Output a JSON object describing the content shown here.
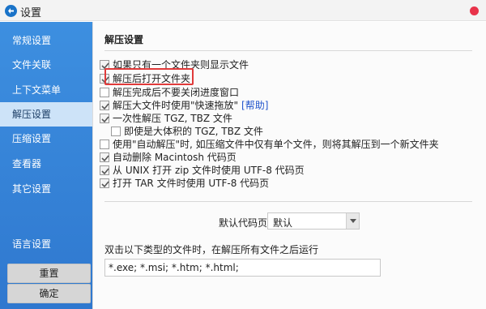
{
  "window": {
    "title": "设置",
    "accent": "#1a73c8",
    "close_color": "#e8334a"
  },
  "sidebar": {
    "items": [
      {
        "label": "常规设置"
      },
      {
        "label": "文件关联"
      },
      {
        "label": "上下文菜单"
      },
      {
        "label": "解压设置",
        "active": true
      },
      {
        "label": "压缩设置"
      },
      {
        "label": "查看器"
      },
      {
        "label": "其它设置"
      },
      {
        "label": "语言设置"
      }
    ],
    "reset_label": "重置",
    "ok_label": "确定",
    "bg_color": "#3a88dc",
    "active_color": "#cde3f8"
  },
  "main": {
    "section_title": "解压设置",
    "options": [
      {
        "label": "如果只有一个文件夹则显示文件",
        "checked": true
      },
      {
        "label": "解压后打开文件夹",
        "checked": true,
        "highlighted": true
      },
      {
        "label": "解压完成后不要关闭进度窗口",
        "checked": false
      },
      {
        "label": "解压大文件时使用\"快速拖放\"",
        "checked": true,
        "link": "[帮助]"
      },
      {
        "label": "一次性解压 TGZ, TBZ 文件",
        "checked": true
      },
      {
        "label": "即使是大体积的 TGZ, TBZ 文件",
        "checked": false,
        "indent": true
      },
      {
        "label": "使用\"自动解压\"时, 如压缩文件中仅有单个文件，则将其解压到一个新文件夹",
        "checked": false
      },
      {
        "label": "自动删除 Macintosh 代码页",
        "checked": true
      },
      {
        "label": "从 UNIX 打开 zip 文件时使用 UTF-8 代码页",
        "checked": true
      },
      {
        "label": "打开 TAR 文件时使用 UTF-8 代码页",
        "checked": true
      }
    ],
    "codepage_label": "默认代码页",
    "codepage_value": "默认",
    "run_label": "双击以下类型的文件时，在解压所有文件之后运行",
    "extensions_value": "*.exe; *.msi; *.htm; *.html;"
  }
}
